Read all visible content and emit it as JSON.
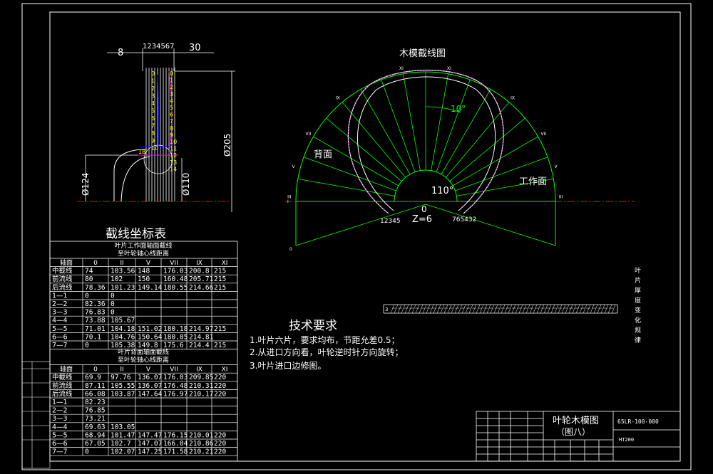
{
  "profile": {
    "dims": [
      "8",
      "1234567",
      "30"
    ],
    "diameters": [
      "Ø124",
      "Ø110",
      "Ø205"
    ],
    "left_nums": [
      "0",
      "1",
      "2",
      "3",
      "4",
      "5",
      "6",
      "7",
      "8",
      "9",
      "10"
    ],
    "right_nums": [
      "0",
      "1",
      "2",
      "3",
      "4",
      "5",
      "6",
      "7",
      "8",
      "9",
      "10",
      "11",
      "12",
      "13",
      "14"
    ],
    "mark_18": "18"
  },
  "pattern": {
    "title": "木模截线图",
    "back_label": "背面",
    "work_label": "工作面",
    "angle_small": "10°",
    "angle_big": "110°",
    "zero": "0",
    "blades": "Z=6",
    "left_seq": "12345",
    "right_seq": "765432",
    "ray_labels": [
      "XI",
      "IX",
      "VII",
      "V",
      "III",
      "I",
      "0"
    ],
    "ray_labels_right": [
      "XI",
      "IX",
      "VII",
      "V",
      "III"
    ]
  },
  "table": {
    "title": "截线坐标表",
    "work_header_1": "叶片工作面轴面截线",
    "work_header_2": "至叶轮轴心线距离",
    "back_header_1": "叶片背面轴面截线",
    "back_header_2": "至叶轮轴心线距离",
    "columns": [
      "轴面",
      "0",
      "II",
      "V",
      "VII",
      "IX",
      "XI"
    ],
    "work_rows": [
      [
        "中截线",
        "74",
        "103.56",
        "148",
        "176.03",
        "200.8",
        "215"
      ],
      [
        "前流线",
        "80",
        "102",
        "150",
        "160.48",
        "205.71",
        "215"
      ],
      [
        "后流线",
        "78.36",
        "101.23",
        "149.14",
        "180.55",
        "214.66",
        "215"
      ],
      [
        "1—1",
        "0",
        "0",
        "",
        "",
        "",
        ""
      ],
      [
        "2—2",
        "82.36",
        "0",
        "",
        "",
        "",
        ""
      ],
      [
        "3—3",
        "76.83",
        "0",
        "",
        "",
        "",
        ""
      ],
      [
        "4—4",
        "73.88",
        "105.67",
        "",
        "",
        "",
        ""
      ],
      [
        "5—5",
        "71.01",
        "104.18",
        "151.02",
        "180.18",
        "214.97",
        "215"
      ],
      [
        "6—6",
        "70.1",
        "104.76",
        "150.64",
        "180.05",
        "214.81",
        ""
      ],
      [
        "7—7",
        "0",
        "105.38",
        "149.8",
        "175.6",
        "214.4",
        "215"
      ]
    ],
    "back_rows": [
      [
        "中截线",
        "69.9",
        "97.76",
        "136.07",
        "176.03",
        "209.85",
        "220"
      ],
      [
        "前流线",
        "87.11",
        "105.55",
        "136.07",
        "176.48",
        "210.31",
        "220"
      ],
      [
        "后流线",
        "66.08",
        "103.87",
        "147.64",
        "176.97",
        "210.17",
        "220"
      ],
      [
        "1—1",
        "82.23",
        "",
        "",
        "",
        "",
        ""
      ],
      [
        "2—2",
        "76.85",
        "",
        "",
        "",
        "",
        ""
      ],
      [
        "3—3",
        "73.21",
        "",
        "",
        "",
        "",
        ""
      ],
      [
        "4—4",
        "69.63",
        "103.05",
        "",
        "",
        "",
        ""
      ],
      [
        "5—5",
        "68.94",
        "101.47",
        "147.47",
        "176.15",
        "210.01",
        "220"
      ],
      [
        "6—6",
        "67.05",
        "102.7",
        "147.07",
        "166.04",
        "210.86",
        "220"
      ],
      [
        "7—7",
        "0",
        "102.07",
        "147.25",
        "171.58",
        "210.21",
        "220"
      ]
    ]
  },
  "requirements": {
    "title": "技术要求",
    "items": [
      "1.叶片六片，要求均布，节距允差0.5；",
      "2.从进口方向看，叶轮逆时针方向旋转；",
      "3.叶片进口边修图。"
    ]
  },
  "thickness": {
    "vertical_label": "叶片厚度变化规律",
    "left_mark": "3"
  },
  "title_block": {
    "name": "叶轮木模图",
    "sub": "（图八）",
    "code": "65LR-100-000",
    "spec": "HT200"
  },
  "colors": {
    "frame": "#ffffff",
    "green": "#00ff00",
    "yellow": "#ffff00",
    "centerline": "#ff0000",
    "blue": "#0000ff",
    "magenta": "#ff00ff"
  }
}
